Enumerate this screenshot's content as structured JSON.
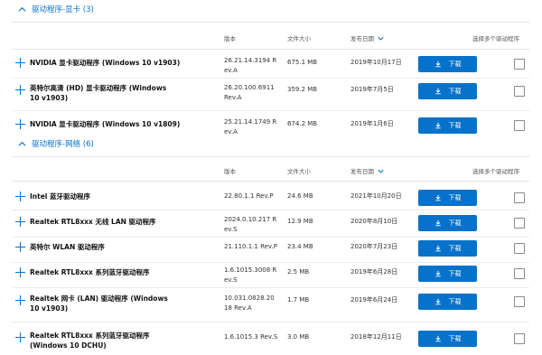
{
  "sections": [
    {
      "title": "驱动程序-显卡 (3)",
      "headers": {
        "version": "版本",
        "size": "文件大小",
        "date": "发布日期",
        "select": "选择多个驱动程序"
      },
      "rows": [
        {
          "name": "NVIDIA 显卡驱动程序 (Windows 10 v1903)",
          "version": "26.21.14.3194 R ev.A",
          "size": "675.1 MB",
          "date": "2019年10月17日",
          "download": "下载"
        },
        {
          "name": "英特尔高清 (HD) 显卡驱动程序 (Windows 10 v1903)",
          "version": "26.20.100.6911 Rev.A",
          "size": "359.2 MB",
          "date": "2019年7月5日",
          "download": "下载"
        },
        {
          "name": "NVIDIA 显卡驱动程序 (Windows 10 v1809)",
          "version": "25.21.14.1749 R ev.A",
          "size": "674.2 MB",
          "date": "2019年1月6日",
          "download": "下载"
        }
      ]
    },
    {
      "title": "驱动程序-网络 (6)",
      "headers": {
        "version": "版本",
        "size": "文件大小",
        "date": "发布日期",
        "select": "选择多个驱动程序"
      },
      "rows": [
        {
          "name": "Intel 蓝牙驱动程序",
          "version": "22.80.1.1 Rev.P",
          "size": "24.6 MB",
          "date": "2021年10月20日",
          "download": "下载"
        },
        {
          "name": "Realtek RTL8xxx 无线 LAN 驱动程序",
          "version": "2024.0.10.217 R ev.S",
          "size": "12.9 MB",
          "date": "2020年8月10日",
          "download": "下载"
        },
        {
          "name": "英特尔 WLAN 驱动程序",
          "version": "21.110.1.1 Rev.P",
          "size": "23.4 MB",
          "date": "2020年7月23日",
          "download": "下载"
        },
        {
          "name": "Realtek RTL8xxx 系列蓝牙驱动程序",
          "version": "1.6.1015.3008 R ev.S",
          "size": "2.5 MB",
          "date": "2019年6月28日",
          "download": "下载"
        },
        {
          "name": "Realtek 网卡 (LAN) 驱动程序 (Windows 10 v1903)",
          "version": "10.031.0828.20 18 Rev.A",
          "size": "1.7 MB",
          "date": "2019年6月24日",
          "download": "下载"
        },
        {
          "name": "Realtek RTL8xxx 系列蓝牙驱动程序 (Windows 10 DCHU)",
          "version": "1.6.1015.3 Rev.S",
          "size": "3.0 MB",
          "date": "2018年12月11日",
          "download": "下载"
        }
      ]
    }
  ]
}
